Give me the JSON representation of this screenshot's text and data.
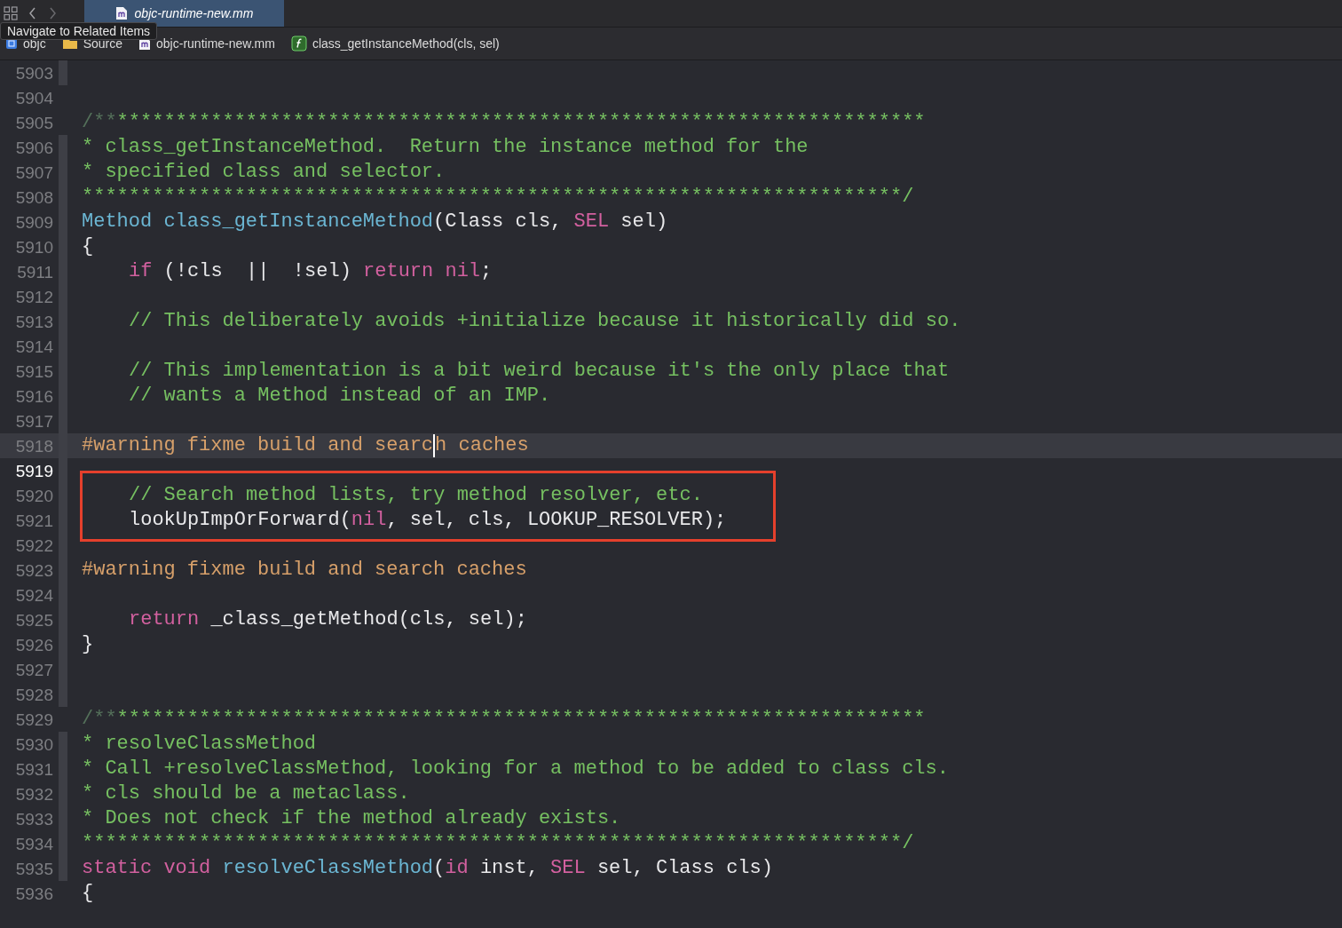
{
  "tab": {
    "title": "objc-runtime-new.mm",
    "selected": true
  },
  "tooltip": "Navigate to Related Items",
  "breadcrumb": [
    {
      "kind": "project",
      "label": "objc"
    },
    {
      "kind": "folder",
      "label": "Source"
    },
    {
      "kind": "file",
      "label": "objc-runtime-new.mm"
    },
    {
      "kind": "function",
      "label": "class_getInstanceMethod(cls, sel)"
    }
  ],
  "lines": [
    {
      "number": "5903",
      "ribbon": true
    },
    {
      "number": "5904",
      "ribbon": false
    },
    {
      "number": "5905",
      "ribbon": false,
      "tokens": [
        {
          "kind": "dim",
          "text": "/**"
        },
        {
          "kind": "doc",
          "text": "*********************************************************************"
        }
      ]
    },
    {
      "number": "5906",
      "ribbon": true,
      "tokens": [
        {
          "kind": "doc",
          "text": "* class_getInstanceMethod.  Return the instance method for the"
        }
      ]
    },
    {
      "number": "5907",
      "ribbon": true,
      "tokens": [
        {
          "kind": "doc",
          "text": "* specified class and selector."
        }
      ]
    },
    {
      "number": "5908",
      "ribbon": true,
      "tokens": [
        {
          "kind": "doc",
          "text": "**********************************************************************/"
        }
      ]
    },
    {
      "number": "5909",
      "ribbon": true,
      "tokens": [
        {
          "kind": "type",
          "text": "Method"
        },
        {
          "kind": "type",
          "text": " class_getInstanceMethod"
        },
        {
          "kind": "plain",
          "text": "(Class cls, "
        },
        {
          "kind": "keyword",
          "text": "SEL"
        },
        {
          "kind": "plain",
          "text": " sel)"
        }
      ]
    },
    {
      "number": "5910",
      "ribbon": true,
      "tokens": [
        {
          "kind": "plain",
          "text": "{"
        }
      ]
    },
    {
      "number": "5911",
      "ribbon": true,
      "indent": true,
      "tokens": [
        {
          "kind": "keyword",
          "text": "if"
        },
        {
          "kind": "plain",
          "text": " (!cls  ||  !sel) "
        },
        {
          "kind": "keyword",
          "text": "return"
        },
        {
          "kind": "keyword",
          "text": " nil"
        },
        {
          "kind": "plain",
          "text": ";"
        }
      ]
    },
    {
      "number": "5912",
      "ribbon": true
    },
    {
      "number": "5913",
      "ribbon": true,
      "indent": true,
      "tokens": [
        {
          "kind": "comment",
          "text": "// This deliberately avoids +initialize because it historically did so."
        }
      ]
    },
    {
      "number": "5914",
      "ribbon": true
    },
    {
      "number": "5915",
      "ribbon": true,
      "indent": true,
      "tokens": [
        {
          "kind": "comment",
          "text": "// This implementation is a bit weird because it's the only place that"
        }
      ]
    },
    {
      "number": "5916",
      "ribbon": true,
      "indent": true,
      "tokens": [
        {
          "kind": "comment",
          "text": "// wants a Method instead of an IMP."
        }
      ]
    },
    {
      "number": "5917",
      "ribbon": true
    },
    {
      "number": "5918",
      "ribbon": true,
      "highlighted": true,
      "tokens": [
        {
          "kind": "preproc",
          "text": "#warning fixme build and searc"
        },
        {
          "kind": "preproc",
          "text": "h caches",
          "cursor_before": true
        }
      ]
    },
    {
      "number": "5919",
      "ribbon": true,
      "current": true
    },
    {
      "number": "5920",
      "ribbon": true,
      "boxed": true,
      "indent": true,
      "tokens": [
        {
          "kind": "comment",
          "text": "// Search method lists, try method resolver, etc."
        }
      ]
    },
    {
      "number": "5921",
      "ribbon": true,
      "boxed": true,
      "indent": true,
      "tokens": [
        {
          "kind": "plain",
          "text": "lookUpImpOrForward("
        },
        {
          "kind": "keyword",
          "text": "nil"
        },
        {
          "kind": "plain",
          "text": ", sel, cls, LOOKUP_RESOLVER);"
        }
      ]
    },
    {
      "number": "5922",
      "ribbon": true
    },
    {
      "number": "5923",
      "ribbon": true,
      "tokens": [
        {
          "kind": "preproc",
          "text": "#warning fixme build and search caches"
        }
      ]
    },
    {
      "number": "5924",
      "ribbon": true
    },
    {
      "number": "5925",
      "ribbon": true,
      "indent": true,
      "tokens": [
        {
          "kind": "keyword",
          "text": "return"
        },
        {
          "kind": "plain",
          "text": " _class_getMethod(cls, sel);"
        }
      ]
    },
    {
      "number": "5926",
      "ribbon": true,
      "tokens": [
        {
          "kind": "plain",
          "text": "}"
        }
      ]
    },
    {
      "number": "5927",
      "ribbon": true
    },
    {
      "number": "5928",
      "ribbon": true
    },
    {
      "number": "5929",
      "ribbon": false,
      "tokens": [
        {
          "kind": "dim",
          "text": "/**"
        },
        {
          "kind": "doc",
          "text": "*********************************************************************"
        }
      ]
    },
    {
      "number": "5930",
      "ribbon": true,
      "tokens": [
        {
          "kind": "doc",
          "text": "* resolveClassMethod"
        }
      ]
    },
    {
      "number": "5931",
      "ribbon": true,
      "tokens": [
        {
          "kind": "doc",
          "text": "* Call +resolveClassMethod, looking for a method to be added to class cls."
        }
      ]
    },
    {
      "number": "5932",
      "ribbon": true,
      "tokens": [
        {
          "kind": "doc",
          "text": "* cls should be a metaclass."
        }
      ]
    },
    {
      "number": "5933",
      "ribbon": true,
      "tokens": [
        {
          "kind": "doc",
          "text": "* Does not check if the method already exists."
        }
      ]
    },
    {
      "number": "5934",
      "ribbon": true,
      "tokens": [
        {
          "kind": "doc",
          "text": "**********************************************************************/"
        }
      ]
    },
    {
      "number": "5935",
      "ribbon": true,
      "tokens": [
        {
          "kind": "keyword",
          "text": "static"
        },
        {
          "kind": "keyword",
          "text": " void"
        },
        {
          "kind": "type",
          "text": " resolveClassMethod"
        },
        {
          "kind": "plain",
          "text": "("
        },
        {
          "kind": "keyword",
          "text": "id"
        },
        {
          "kind": "plain",
          "text": " inst, "
        },
        {
          "kind": "keyword",
          "text": "SEL"
        },
        {
          "kind": "plain",
          "text": " sel, Class cls)"
        }
      ]
    },
    {
      "number": "5936",
      "ribbon": false,
      "tokens": [
        {
          "kind": "plain",
          "text": "{"
        }
      ]
    }
  ]
}
